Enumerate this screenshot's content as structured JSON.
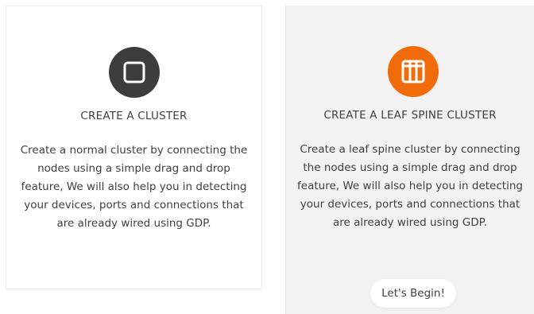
{
  "cards": [
    {
      "icon": "square-icon",
      "icon_color": "#3d3d3d",
      "title": "CREATE A CLUSTER",
      "description_lines": [
        "Create a normal cluster by connecting the",
        "nodes using a simple drag and drop",
        "feature, We will also help you in detecting",
        "your devices, ports and connections that",
        "are already wired using GDP."
      ]
    },
    {
      "icon": "leaf-spine-icon",
      "icon_color": "#f26b0a",
      "title": "CREATE A LEAF SPINE CLUSTER",
      "description_lines": [
        "Create a leaf spine cluster by connecting",
        "the nodes using a simple drag and drop",
        "feature, We will also help you in detecting",
        "your devices, ports and connections that",
        "are already wired using GDP."
      ],
      "button_label": "Let's Begin!"
    }
  ]
}
